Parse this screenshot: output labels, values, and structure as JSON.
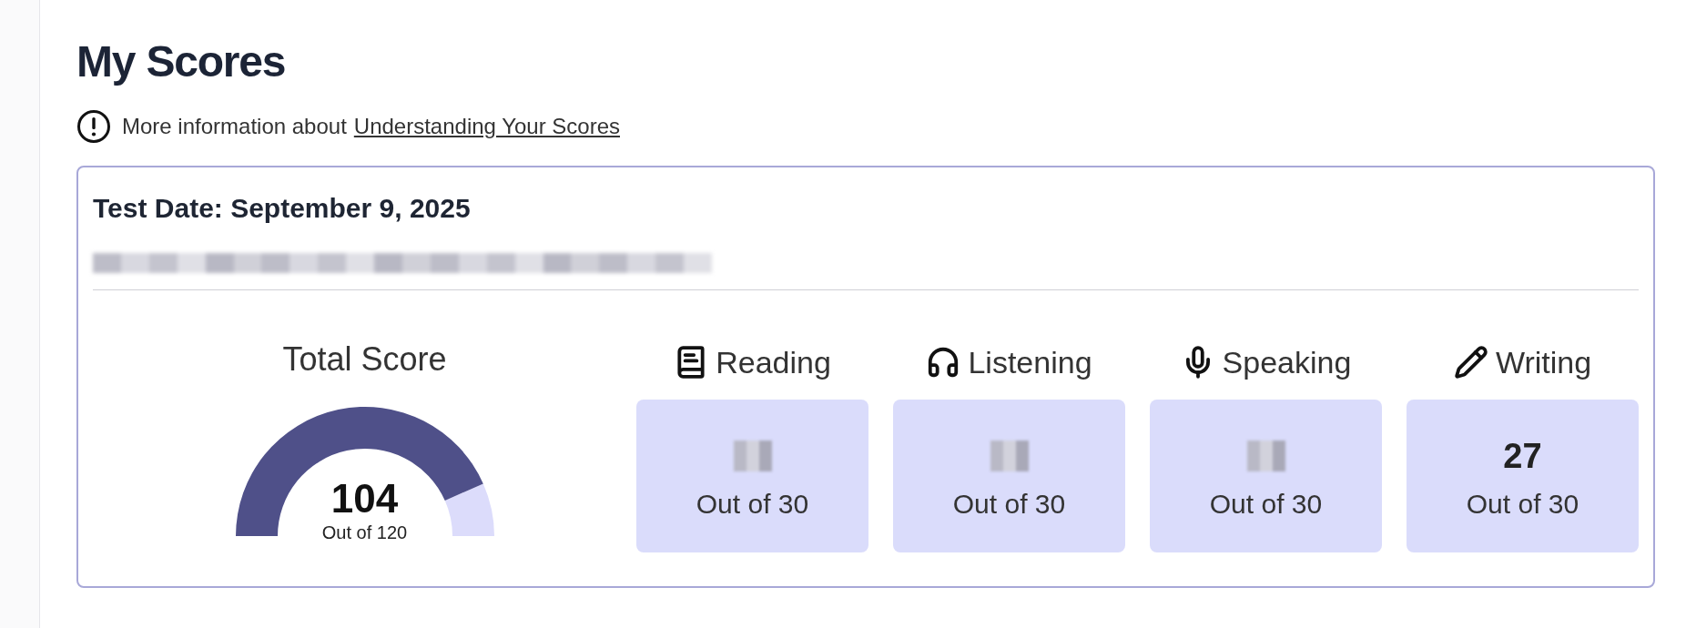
{
  "page": {
    "title": "My Scores"
  },
  "info": {
    "text": "More information about",
    "link": "Understanding Your Scores"
  },
  "test": {
    "date_label": "Test Date: September 9, 2025",
    "details_redacted": true,
    "total": {
      "label": "Total Score",
      "value": "104",
      "caption": "Out of 120"
    },
    "sections": [
      {
        "kind": "book",
        "label": "Reading",
        "value_redacted": true,
        "caption": "Out of 30"
      },
      {
        "kind": "headphones",
        "label": "Listening",
        "value_redacted": true,
        "caption": "Out of 30"
      },
      {
        "kind": "mic",
        "label": "Speaking",
        "value_redacted": true,
        "caption": "Out of 30"
      },
      {
        "kind": "pencil",
        "label": "Writing",
        "value_redacted": false,
        "value": "27",
        "caption": "Out of 30"
      }
    ]
  }
}
